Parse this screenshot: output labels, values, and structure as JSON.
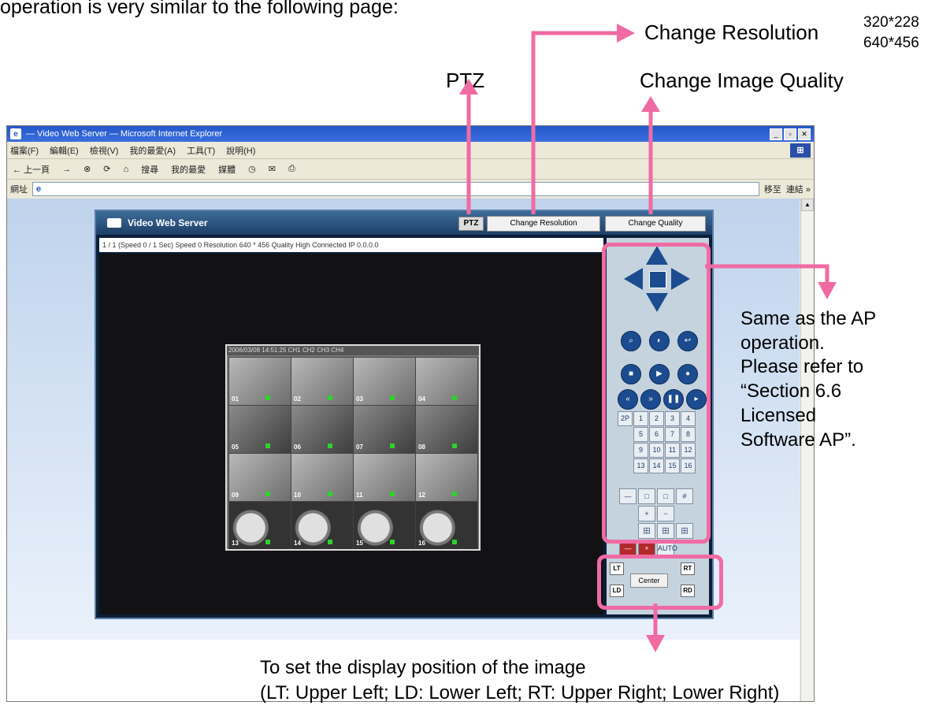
{
  "annotations": {
    "intro_text": "operation is very similar to the following page:",
    "ptz": "PTZ",
    "change_resolution": "Change Resolution",
    "resolution_options": [
      "320*228",
      "640*456"
    ],
    "change_image_quality": "Change Image Quality",
    "same_as_ap": [
      "Same as the AP",
      "operation.",
      "Please refer to",
      "“Section 6.6",
      "Licensed",
      "Software AP”."
    ],
    "display_position": [
      "To set the display position of the  image",
      "(LT: Upper Left; LD: Lower Left; RT: Upper Right; Lower Right)"
    ]
  },
  "browser": {
    "title": "— Video Web Server — Microsoft Internet Explorer",
    "menu": [
      "檔案(F)",
      "編輯(E)",
      "檢視(V)",
      "我的最愛(A)",
      "工具(T)",
      "說明(H)"
    ],
    "toolbar": [
      "上一頁",
      "下一頁",
      "停止",
      "重新整理",
      "首頁",
      "搜尋",
      "我的最愛",
      "媒體",
      "記錄",
      "郵件",
      "列印"
    ],
    "address_label": "網址",
    "address_value": "",
    "go_button": "移至",
    "links_button": "連結 »"
  },
  "app": {
    "title": "Video Web Server",
    "ptz_button": "PTZ",
    "change_resolution_button": "Change Resolution",
    "change_quality_button": "Change Quality",
    "status_text": "1 / 1 (Speed 0 / 1 Sec) Speed 0 Resolution 640 * 456 Quality High Connected IP 0.0.0.0",
    "frame_header": "2006/03/08  14:51:25  CH1  CH2  CH3  CH4",
    "cells": [
      [
        "01",
        "02",
        "03",
        "04"
      ],
      [
        "05",
        "06",
        "07",
        "08"
      ],
      [
        "09",
        "10",
        "11",
        "12"
      ],
      [
        "13",
        "14",
        "15",
        "16"
      ]
    ],
    "round_row1": [
      "Zoom",
      "Focus",
      "Back"
    ],
    "round_row2": [
      "Stop",
      "Play",
      "Rec"
    ],
    "round_row3": [
      "Rew",
      "FF",
      "Pause",
      "Step"
    ],
    "num_rows": [
      [
        "2P",
        "1",
        "2",
        "3",
        "4"
      ],
      [
        "",
        "5",
        "6",
        "7",
        "8"
      ],
      [
        "",
        "9",
        "10",
        "11",
        "12"
      ],
      [
        "",
        "13",
        "14",
        "15",
        "16"
      ]
    ],
    "layout_rows": [
      [
        "—",
        "□",
        "□",
        "#"
      ],
      [
        "",
        "+",
        "−",
        ""
      ],
      [
        "",
        "田",
        "田",
        "田"
      ],
      [
        "—",
        "+",
        "AUTO",
        ""
      ]
    ],
    "pos_lt": "LT",
    "pos_ld": "LD",
    "pos_rt": "RT",
    "pos_rd": "RD",
    "center_button": "Center"
  },
  "colors": {
    "annotation_pink": "#f06ba4",
    "app_background": "#0b1e38",
    "panel_background": "#c5d3df"
  }
}
